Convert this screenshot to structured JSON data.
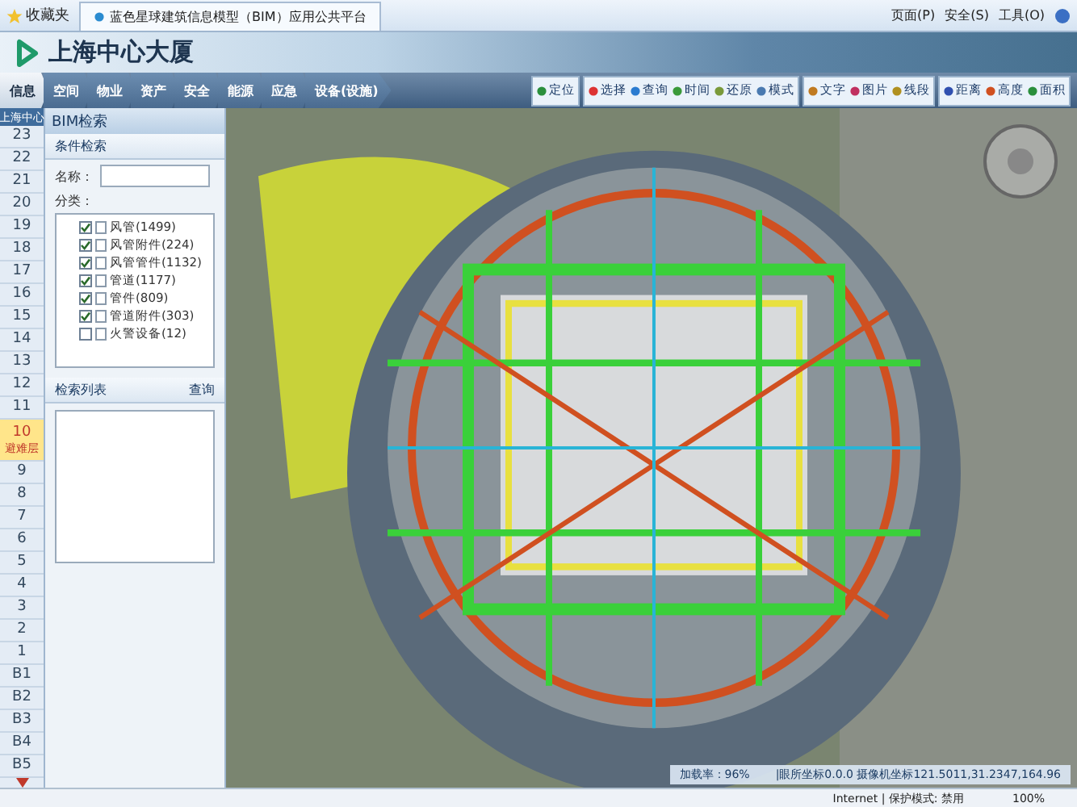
{
  "browser": {
    "favorites": "收藏夹",
    "tab_title": "蓝色星球建筑信息模型（BIM）应用公共平台",
    "menus": [
      "页面(P)",
      "安全(S)",
      "工具(O)"
    ]
  },
  "header": {
    "logo_text": "上海中心大厦"
  },
  "nav": [
    {
      "label": "信息",
      "selected": true
    },
    {
      "label": "空间",
      "selected": false
    },
    {
      "label": "物业",
      "selected": false
    },
    {
      "label": "资产",
      "selected": false
    },
    {
      "label": "安全",
      "selected": false
    },
    {
      "label": "能源",
      "selected": false
    },
    {
      "label": "应急",
      "selected": false
    },
    {
      "label": "设备(设施)",
      "selected": false
    }
  ],
  "toolbar_groups": [
    [
      "定位"
    ],
    [
      "选择",
      "查询",
      "时间",
      "还原",
      "模式"
    ],
    [
      "文字",
      "图片",
      "线段"
    ],
    [
      "距离",
      "高度",
      "面积"
    ]
  ],
  "floors": {
    "title": "上海中心",
    "items": [
      {
        "label": "23",
        "selected": false
      },
      {
        "label": "22",
        "selected": false
      },
      {
        "label": "21",
        "selected": false
      },
      {
        "label": "20",
        "selected": false
      },
      {
        "label": "19",
        "selected": false
      },
      {
        "label": "18",
        "selected": false
      },
      {
        "label": "17",
        "selected": false
      },
      {
        "label": "16",
        "selected": false
      },
      {
        "label": "15",
        "selected": false
      },
      {
        "label": "14",
        "selected": false
      },
      {
        "label": "13",
        "selected": false
      },
      {
        "label": "12",
        "selected": false
      },
      {
        "label": "11",
        "selected": false
      },
      {
        "label": "10",
        "note": "避难层",
        "selected": true
      },
      {
        "label": "9",
        "selected": false
      },
      {
        "label": "8",
        "selected": false
      },
      {
        "label": "7",
        "selected": false
      },
      {
        "label": "6",
        "selected": false
      },
      {
        "label": "5",
        "selected": false
      },
      {
        "label": "4",
        "selected": false
      },
      {
        "label": "3",
        "selected": false
      },
      {
        "label": "2",
        "selected": false
      },
      {
        "label": "1",
        "selected": false
      },
      {
        "label": "B1",
        "selected": false
      },
      {
        "label": "B2",
        "selected": false
      },
      {
        "label": "B3",
        "selected": false
      },
      {
        "label": "B4",
        "selected": false
      },
      {
        "label": "B5",
        "selected": false
      }
    ]
  },
  "panel": {
    "title": "BIM检索",
    "condition_title": "条件检索",
    "name_label": "名称：",
    "category_label": "分类：",
    "categories": [
      {
        "label": "风管(1499)",
        "checked": true
      },
      {
        "label": "风管附件(224)",
        "checked": true
      },
      {
        "label": "风管管件(1132)",
        "checked": true
      },
      {
        "label": "管道(1177)",
        "checked": true
      },
      {
        "label": "管件(809)",
        "checked": true
      },
      {
        "label": "管道附件(303)",
        "checked": true
      },
      {
        "label": "火警设备(12)",
        "checked": false
      }
    ],
    "results_title": "检索列表",
    "query_link": "查询"
  },
  "status": {
    "load": "加载率：96%",
    "coords": "|眼所坐标0.0.0 摄像机坐标121.5011,31.2347,164.96"
  },
  "browser_status": {
    "zone": "Internet | 保护模式: 禁用",
    "zoom": "100%"
  }
}
